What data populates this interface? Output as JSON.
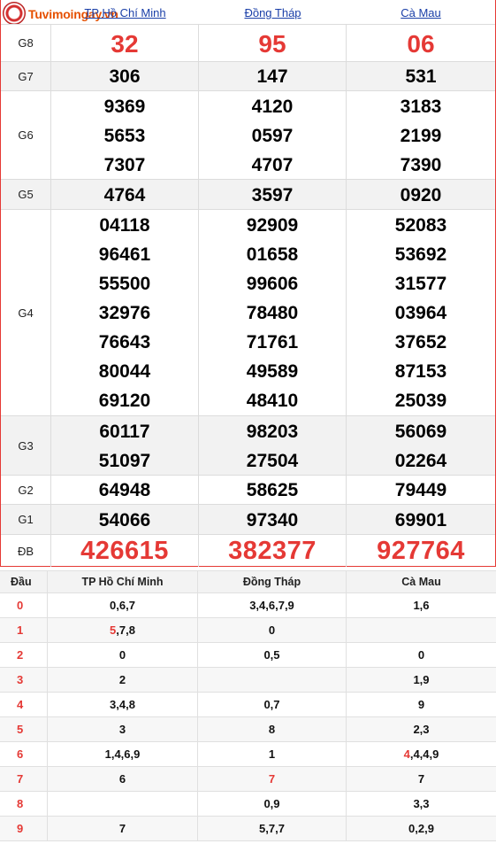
{
  "header": {
    "logo_text": "Tuvimoingay.vn",
    "columns": [
      "TP Hồ Chí Minh",
      "Đồng Tháp",
      "Cà Mau"
    ]
  },
  "prizes": [
    {
      "label": "G8",
      "values": [
        [
          "32"
        ],
        [
          "95"
        ],
        [
          "06"
        ]
      ],
      "style": "red"
    },
    {
      "label": "G7",
      "values": [
        [
          "306"
        ],
        [
          "147"
        ],
        [
          "531"
        ]
      ]
    },
    {
      "label": "G6",
      "values": [
        [
          "9369",
          "5653",
          "7307"
        ],
        [
          "4120",
          "0597",
          "4707"
        ],
        [
          "3183",
          "2199",
          "7390"
        ]
      ]
    },
    {
      "label": "G5",
      "values": [
        [
          "4764"
        ],
        [
          "3597"
        ],
        [
          "0920"
        ]
      ]
    },
    {
      "label": "G4",
      "values": [
        [
          "04118",
          "96461",
          "55500",
          "32976",
          "76643",
          "80044",
          "69120"
        ],
        [
          "92909",
          "01658",
          "99606",
          "78480",
          "71761",
          "49589",
          "48410"
        ],
        [
          "52083",
          "53692",
          "31577",
          "03964",
          "37652",
          "87153",
          "25039"
        ]
      ]
    },
    {
      "label": "G3",
      "values": [
        [
          "60117",
          "51097"
        ],
        [
          "98203",
          "27504"
        ],
        [
          "56069",
          "02264"
        ]
      ]
    },
    {
      "label": "G2",
      "values": [
        [
          "64948"
        ],
        [
          "58625"
        ],
        [
          "79449"
        ]
      ]
    },
    {
      "label": "G1",
      "values": [
        [
          "54066"
        ],
        [
          "97340"
        ],
        [
          "69901"
        ]
      ]
    },
    {
      "label": "ĐB",
      "values": [
        [
          "426615"
        ],
        [
          "382377"
        ],
        [
          "927764"
        ]
      ],
      "style": "db"
    }
  ],
  "dau_table": {
    "headers": [
      "Đầu",
      "TP Hồ Chí Minh",
      "Đồng Tháp",
      "Cà Mau"
    ],
    "rows": [
      {
        "dau": "0",
        "cells": [
          "0,6,7",
          "3,4,6,7,9",
          "1,6"
        ]
      },
      {
        "dau": "1",
        "cells": [
          "5,7,8",
          "0",
          ""
        ],
        "red_prefix": [
          [
            "5"
          ],
          null,
          null
        ]
      },
      {
        "dau": "2",
        "cells": [
          "0",
          "0,5",
          "0"
        ]
      },
      {
        "dau": "3",
        "cells": [
          "2",
          "",
          "1,9"
        ]
      },
      {
        "dau": "4",
        "cells": [
          "3,4,8",
          "0,7",
          "9"
        ]
      },
      {
        "dau": "5",
        "cells": [
          "3",
          "8",
          "2,3"
        ]
      },
      {
        "dau": "6",
        "cells": [
          "1,4,6,9",
          "1",
          "4,4,4,9"
        ],
        "red_prefix": [
          null,
          null,
          [
            "4"
          ]
        ]
      },
      {
        "dau": "7",
        "cells": [
          "6",
          "7",
          "7"
        ],
        "red_prefix": [
          null,
          [
            "7"
          ],
          null
        ]
      },
      {
        "dau": "8",
        "cells": [
          "",
          "0,9",
          "3,3"
        ]
      },
      {
        "dau": "9",
        "cells": [
          "7",
          "5,7,7",
          "0,2,9"
        ]
      }
    ]
  },
  "colors": {
    "accent": "#e53935",
    "link": "#1a3fa8",
    "border": "#dcdcdc"
  }
}
